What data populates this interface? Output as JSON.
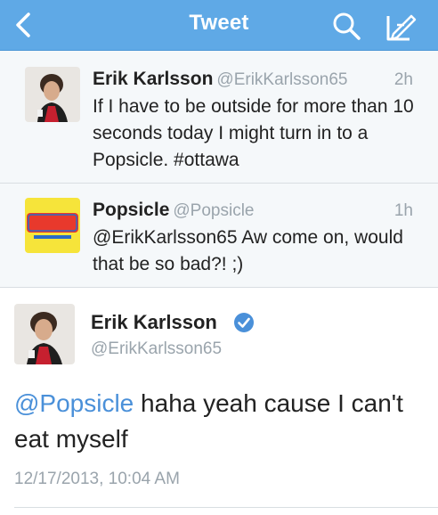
{
  "nav": {
    "title": "Tweet",
    "back_icon": "chevron-left-icon",
    "search_icon": "search-icon",
    "compose_icon": "compose-icon",
    "bar_color": "#5fa9e6"
  },
  "tweets": [
    {
      "name": "Erik Karlsson",
      "handle": "@ErikKarlsson65",
      "time": "2h",
      "text": "If I have to be outside for more than 10 seconds today I might turn in to a Popsicle. #ottawa"
    },
    {
      "name": "Popsicle",
      "handle": "@Popsicle",
      "time": "1h",
      "text": "@ErikKarlsson65 Aw come on, would that be so bad?! ;)"
    }
  ],
  "main_tweet": {
    "name": "Erik Karlsson",
    "handle": "@ErikKarlsson65",
    "verified_icon": "verified-badge-icon",
    "mention": "@Popsicle",
    "text": " haha yeah cause I can't eat myself",
    "timestamp": "12/17/2013, 10:04 AM"
  },
  "logo_text": "Popsicle"
}
